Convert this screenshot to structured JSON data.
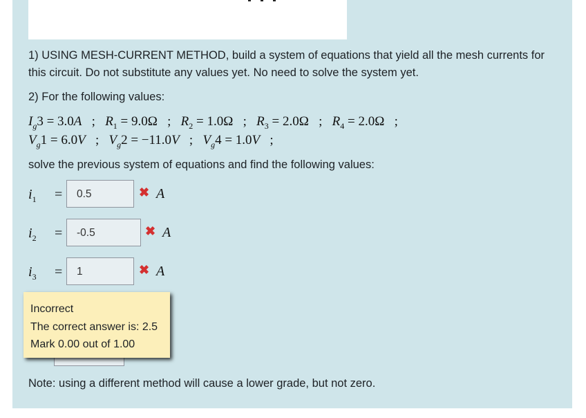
{
  "question": {
    "part1": "1) USING MESH-CURRENT METHOD, build a system of equations that yield all the mesh currents for this circuit. Do not substitute any values yet. No need to solve the system yet.",
    "part2": "2) For the following values:",
    "values_line1": "I_g3 = 3.0A ; R_1 = 9.0Ω ; R_2 = 1.0Ω ; R_3 = 2.0Ω ; R_4 = 2.0Ω ;",
    "values_line2": "V_g1 = 6.0V ; V_g2 = −11.0V ; V_g4 = 1.0V ;",
    "solve_instruction": "solve the previous system of equations and find the following values:",
    "note": "Note: using a different method will cause a lower grade, but not zero."
  },
  "params": [
    {
      "sym": "I",
      "sub": "g",
      "tail": "3",
      "val": "3.0",
      "unit": "A"
    },
    {
      "sym": "R",
      "sub": "1",
      "tail": "",
      "val": "9.0",
      "unit": "Ω"
    },
    {
      "sym": "R",
      "sub": "2",
      "tail": "",
      "val": "1.0",
      "unit": "Ω"
    },
    {
      "sym": "R",
      "sub": "3",
      "tail": "",
      "val": "2.0",
      "unit": "Ω"
    },
    {
      "sym": "R",
      "sub": "4",
      "tail": "",
      "val": "2.0",
      "unit": "Ω"
    },
    {
      "sym": "V",
      "sub": "g",
      "tail": "1",
      "val": "6.0",
      "unit": "V"
    },
    {
      "sym": "V",
      "sub": "g",
      "tail": "2",
      "val": "−11.0",
      "unit": "V"
    },
    {
      "sym": "V",
      "sub": "g",
      "tail": "4",
      "val": "1.0",
      "unit": "V"
    }
  ],
  "answers": [
    {
      "var": "i",
      "sub": "1",
      "value": "0.5",
      "status": "✖",
      "unit": "A"
    },
    {
      "var": "i",
      "sub": "2",
      "value": "-0.5",
      "status": "✖",
      "unit": "A"
    },
    {
      "var": "i",
      "sub": "3",
      "value": "1",
      "status": "✖",
      "unit": "A"
    }
  ],
  "feedback": {
    "state": "Incorrect",
    "correct_answer": "The correct answer is: 2.5",
    "mark": "Mark 0.00 out of 1.00"
  },
  "colors": {
    "panel": "#cfe5ea",
    "incorrect": "#d43030",
    "feedback_bg": "#fcefba"
  }
}
